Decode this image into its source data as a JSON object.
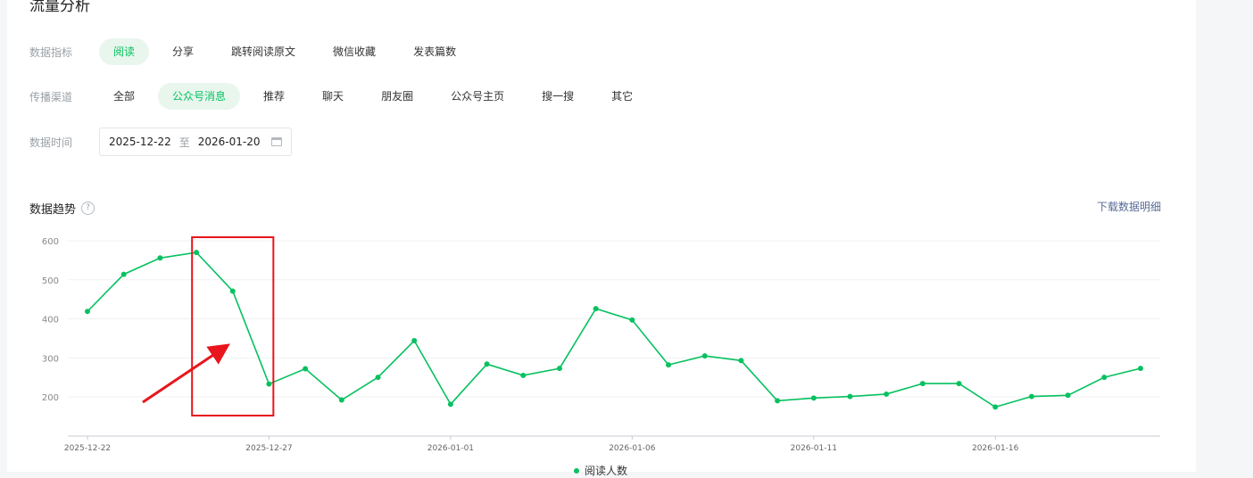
{
  "page": {
    "title": "流量分析"
  },
  "filters": {
    "metric": {
      "label": "数据指标",
      "options": [
        "阅读",
        "分享",
        "跳转阅读原文",
        "微信收藏",
        "发表篇数"
      ],
      "selected": 0
    },
    "channel": {
      "label": "传播渠道",
      "options": [
        "全部",
        "公众号消息",
        "推荐",
        "聊天",
        "朋友圈",
        "公众号主页",
        "搜一搜",
        "其它"
      ],
      "selected": 1
    },
    "date": {
      "label": "数据时间",
      "start": "2025-12-22",
      "separator": "至",
      "end": "2026-01-20"
    }
  },
  "trend": {
    "title": "数据趋势",
    "help": "?",
    "download": "下载数据明细"
  },
  "colors": {
    "accent": "#07c160",
    "highlight": "#e8151c",
    "link": "#576b95"
  },
  "chart_data": {
    "type": "line",
    "x": [
      "2025-12-22",
      "2025-12-23",
      "2025-12-24",
      "2025-12-25",
      "2025-12-26",
      "2025-12-27",
      "2025-12-28",
      "2025-12-29",
      "2025-12-30",
      "2025-12-31",
      "2026-01-01",
      "2026-01-02",
      "2026-01-03",
      "2026-01-04",
      "2026-01-05",
      "2026-01-06",
      "2026-01-07",
      "2026-01-08",
      "2026-01-09",
      "2026-01-10",
      "2026-01-11",
      "2026-01-12",
      "2026-01-13",
      "2026-01-14",
      "2026-01-15",
      "2026-01-16",
      "2026-01-17",
      "2026-01-18",
      "2026-01-19",
      "2026-01-20"
    ],
    "xticks": [
      "2025-12-22",
      "2025-12-27",
      "2026-01-01",
      "2026-01-06",
      "2026-01-11",
      "2026-01-16"
    ],
    "yticks": [
      200,
      300,
      400,
      500,
      600
    ],
    "ylim": [
      150,
      640
    ],
    "series": [
      {
        "name": "阅读人数",
        "values": [
          419,
          514,
          556,
          570,
          471,
          233,
          272,
          192,
          250,
          344,
          181,
          284,
          255,
          273,
          426,
          397,
          282,
          305,
          293,
          190,
          197,
          201,
          207,
          234,
          234,
          174,
          201,
          204,
          250,
          273
        ]
      }
    ],
    "highlight": {
      "from": "2025-12-25",
      "to": "2025-12-27",
      "note": "annotated region (red box with arrow)"
    },
    "grid": true,
    "legend": "bottom-center"
  }
}
